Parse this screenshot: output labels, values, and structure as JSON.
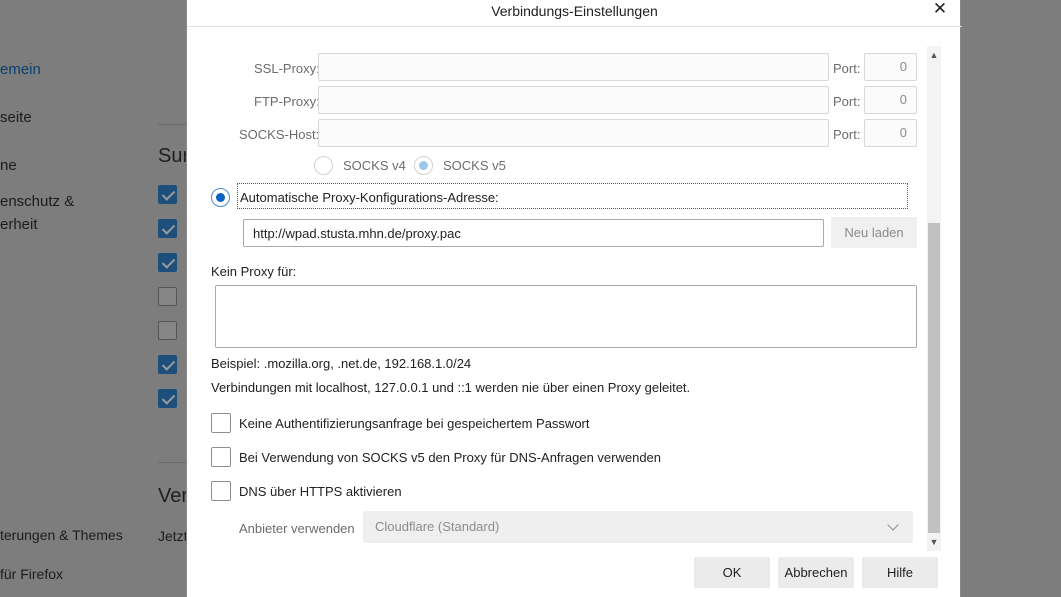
{
  "background": {
    "nav": [
      "emein",
      "seite",
      "ne",
      "enschutz &",
      "erheit",
      "terungen & Themes",
      "für Firefox"
    ],
    "heading1": "Sur",
    "heading2": "Ver",
    "partial_text": "Jetzt",
    "checkboxes": [
      true,
      true,
      true,
      false,
      false,
      true,
      true
    ]
  },
  "dialog": {
    "title": "Verbindungs-Einstellungen",
    "close_glyph": "✕",
    "proxies": [
      {
        "label": "SSL-Proxy:",
        "value": "",
        "port_label": "Port:",
        "port": "0"
      },
      {
        "label": "FTP-Proxy:",
        "value": "",
        "port_label": "Port:",
        "port": "0"
      },
      {
        "label": "SOCKS-Host:",
        "value": "",
        "port_label": "Port:",
        "port": "0"
      }
    ],
    "socks_v4": "SOCKS v4",
    "socks_v5": "SOCKS v5",
    "auto_proxy_label": "Automatische Proxy-Konfigurations-Adresse:",
    "auto_proxy_url": "http://wpad.stusta.mhn.de/proxy.pac",
    "reload_button": "Neu laden",
    "no_proxy_label": "Kein Proxy für:",
    "no_proxy_value": "",
    "example_text": "Beispiel: .mozilla.org, .net.de, 192.168.1.0/24",
    "localhost_note": "Verbindungen mit localhost, 127.0.0.1 und ::1 werden nie über einen Proxy geleitet.",
    "options": [
      {
        "label": "Keine Authentifizierungsanfrage bei gespeichertem Passwort",
        "checked": false
      },
      {
        "label": "Bei Verwendung von SOCKS v5 den Proxy für DNS-Anfragen verwenden",
        "checked": false
      },
      {
        "label": "DNS über HTTPS aktivieren",
        "checked": false
      }
    ],
    "provider_label": "Anbieter verwenden",
    "provider_value": "Cloudflare (Standard)",
    "buttons": {
      "ok": "OK",
      "cancel": "Abbrechen",
      "help": "Hilfe"
    },
    "scroll_up": "▲",
    "scroll_down": "▼"
  },
  "colors": {
    "accent": "#0b62c1",
    "overlay": "#7d7d7d"
  }
}
